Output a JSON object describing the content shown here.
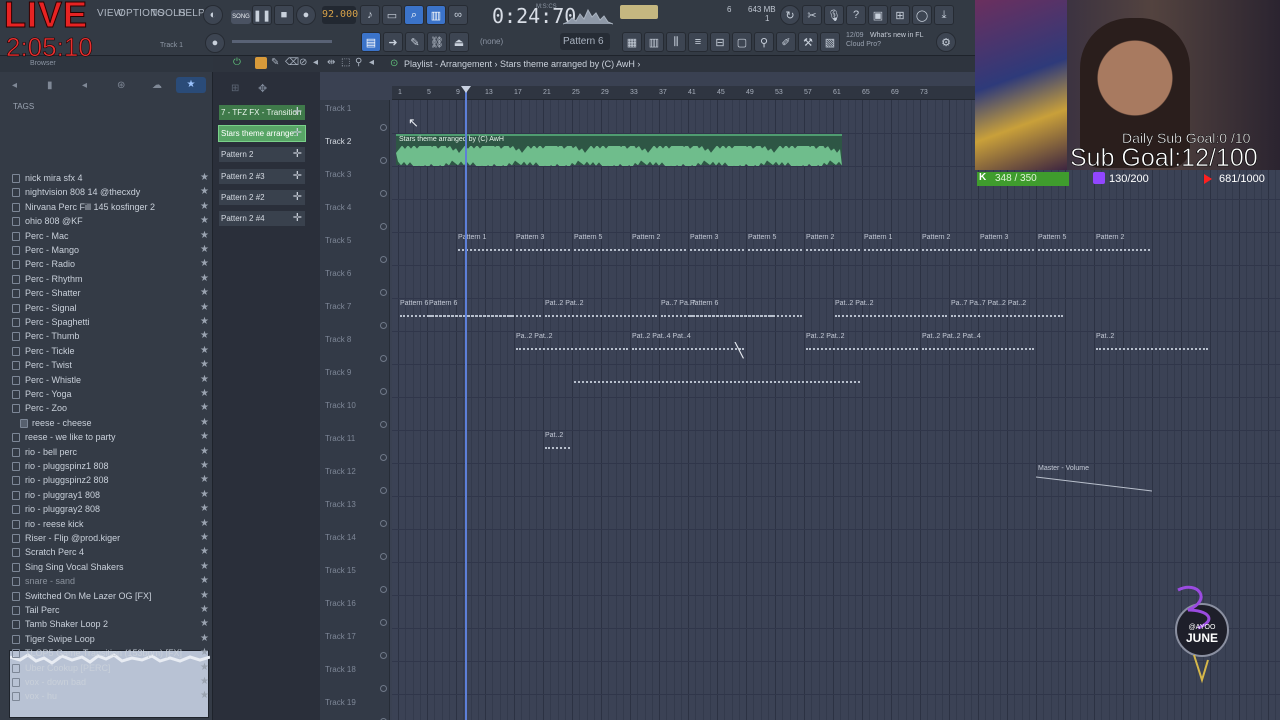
{
  "overlay": {
    "live_label": "LIVE",
    "live_timer": "2:05:10",
    "daily_goal": "Daily Sub Goal:0 /10",
    "sub_goal": "Sub Goal:12/100",
    "kick_count": "348 / 350",
    "twitch_count": "130/200",
    "youtube_count": "681/1000",
    "logo_text": "@AYOO JUNE"
  },
  "toolbar": {
    "menu": [
      "VIEW",
      "OPTIONS",
      "TOOLS",
      "HELP"
    ],
    "song_mode": "SONG",
    "tempo": "92.000",
    "song_time": "0:24:70",
    "time_unit": "M:S:CS",
    "cpu_value": "6",
    "memory": "643 MB",
    "cpu_sub": "1",
    "pattern_selector": "Pattern 6",
    "none_label": "(none)",
    "track_label": "Track 1",
    "news_date": "12/09",
    "news_title": "What's new in FL",
    "news_text": "Cloud Pro?"
  },
  "browser": {
    "title": "Browser",
    "tags_label": "TAGS",
    "items": [
      {
        "label": "nick mira sfx 4",
        "type": "file"
      },
      {
        "label": "nightvision 808 14 @thecxdy",
        "type": "file"
      },
      {
        "label": "Nirvana Perc Fill 145 kosfinger 2",
        "type": "file"
      },
      {
        "label": "ohio 808 @KF",
        "type": "file"
      },
      {
        "label": "Perc - Mac",
        "type": "file"
      },
      {
        "label": "Perc - Mango",
        "type": "file"
      },
      {
        "label": "Perc - Radio",
        "type": "file"
      },
      {
        "label": "Perc - Rhythm",
        "type": "file"
      },
      {
        "label": "Perc - Shatter",
        "type": "file"
      },
      {
        "label": "Perc - Signal",
        "type": "file"
      },
      {
        "label": "Perc - Spaghetti",
        "type": "file"
      },
      {
        "label": "Perc - Thumb",
        "type": "file"
      },
      {
        "label": "Perc - Tickle",
        "type": "file"
      },
      {
        "label": "Perc - Twist",
        "type": "file"
      },
      {
        "label": "Perc - Whistle",
        "type": "file"
      },
      {
        "label": "Perc - Yoga",
        "type": "file"
      },
      {
        "label": "Perc - Zoo",
        "type": "file"
      },
      {
        "label": "reese - cheese",
        "type": "folder"
      },
      {
        "label": "reese - we like to party",
        "type": "file"
      },
      {
        "label": "rio - bell perc",
        "type": "file"
      },
      {
        "label": "rio - pluggspinz1 808",
        "type": "file"
      },
      {
        "label": "rio - pluggspinz2 808",
        "type": "file"
      },
      {
        "label": "rio - pluggray1 808",
        "type": "file"
      },
      {
        "label": "rio - pluggray2 808",
        "type": "file"
      },
      {
        "label": "rio - reese kick",
        "type": "file"
      },
      {
        "label": "Riser - Flip @prod.kiger",
        "type": "file"
      },
      {
        "label": "Scratch Perc 4",
        "type": "file"
      },
      {
        "label": "Sing Sing Vocal Shakers",
        "type": "file"
      },
      {
        "label": "snare - sand",
        "type": "dim"
      },
      {
        "label": "Switched On Me Lazer OG [FX]",
        "type": "file"
      },
      {
        "label": "Tail Perc",
        "type": "file"
      },
      {
        "label": "Tamb Shaker Loop 2",
        "type": "file"
      },
      {
        "label": "Tiger Swipe Loop",
        "type": "file"
      },
      {
        "label": "TLOP5 Game Transition (153bpm) [FX]",
        "type": "file"
      },
      {
        "label": "Uber Cookup [PERC]",
        "type": "file"
      },
      {
        "label": "vox - down bad",
        "type": "file"
      },
      {
        "label": "vox - hu",
        "type": "file"
      }
    ]
  },
  "patterns": [
    {
      "label": "7 - TFZ FX - Transition",
      "style": "green"
    },
    {
      "label": "Stars theme arrange..",
      "style": "sel"
    },
    {
      "label": "Pattern 2",
      "style": "plain"
    },
    {
      "label": "Pattern 2 #3",
      "style": "plain"
    },
    {
      "label": "Pattern 2 #2",
      "style": "plain"
    },
    {
      "label": "Pattern 2 #4",
      "style": "plain"
    }
  ],
  "playlist": {
    "title": "Playlist - Arrangement › Stars theme arranged by (C) AwH ›",
    "bar_numbers": [
      "1",
      "5",
      "9",
      "13",
      "17",
      "21",
      "25",
      "29",
      "33",
      "37",
      "41",
      "45",
      "49",
      "53",
      "57",
      "61",
      "65",
      "69",
      "73"
    ],
    "tracks": [
      "Track 1",
      "Track 2",
      "Track 3",
      "Track 4",
      "Track 5",
      "Track 6",
      "Track 7",
      "Track 8",
      "Track 9",
      "Track 10",
      "Track 11",
      "Track 12",
      "Track 13",
      "Track 14",
      "Track 15",
      "Track 16",
      "Track 17",
      "Track 18",
      "Track 19"
    ],
    "audio_clip_label": "Stars theme arranged by (C) AwH",
    "track5_clips": [
      "Pattern 1",
      "Pattern 3",
      "Pattern 5",
      "Pattern 2",
      "Pattern 3",
      "Pattern 5",
      "Pattern 2",
      "Pattern 1",
      "Pattern 2",
      "Pattern 3",
      "Pattern 5",
      "Pattern 2"
    ],
    "track7_clips": [
      {
        "label": "Pattern 6",
        "bar": 1
      },
      {
        "label": "Pattern 6",
        "bar": 5
      },
      {
        "label": "Pat..2  Pat..2",
        "bar": 21
      },
      {
        "label": "Pa..7  Pa..7",
        "bar": 37
      },
      {
        "label": "Pattern 6",
        "bar": 41
      },
      {
        "label": "Pat..2  Pat..2",
        "bar": 61
      },
      {
        "label": "Pa..7  Pa..7  Pat..2  Pat..2",
        "bar": 77
      }
    ],
    "track8_clips": [
      {
        "label": "Pa..2  Pat..2",
        "bar": 17
      },
      {
        "label": "Pat..2  Pat..4  Pat..4",
        "bar": 33
      },
      {
        "label": "Pat..2  Pat..2",
        "bar": 57
      },
      {
        "label": "Pat..2  Pat..2  Pat..4",
        "bar": 73
      },
      {
        "label": "Pat..2",
        "bar": 97
      }
    ],
    "track11_clip": "Pat..2",
    "automation_label": "Master - Volume"
  }
}
